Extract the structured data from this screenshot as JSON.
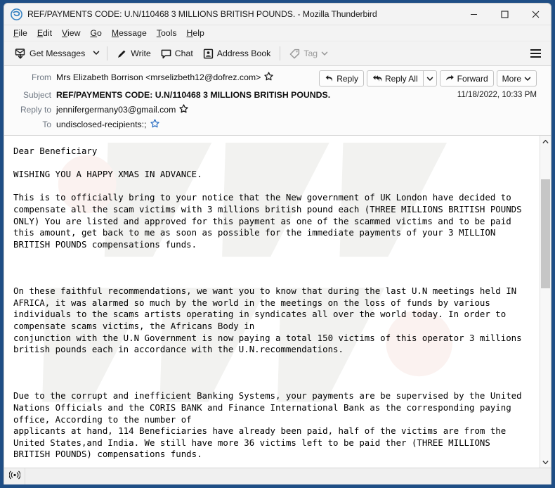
{
  "window": {
    "title": "REF/PAYMENTS CODE: U.N/110468 3 MILLIONS BRITISH POUNDS. - Mozilla Thunderbird",
    "app_icon": "thunderbird-icon",
    "controls": {
      "minimize": "minimize-icon",
      "maximize": "maximize-icon",
      "close": "close-icon"
    },
    "accent_color": "#1f4e85",
    "chrome_color": "#f3f3f3"
  },
  "menubar": {
    "items": [
      {
        "label": "File",
        "accel": "F"
      },
      {
        "label": "Edit",
        "accel": "E"
      },
      {
        "label": "View",
        "accel": "V"
      },
      {
        "label": "Go",
        "accel": "G"
      },
      {
        "label": "Message",
        "accel": "M"
      },
      {
        "label": "Tools",
        "accel": "T"
      },
      {
        "label": "Help",
        "accel": "H"
      }
    ]
  },
  "toolbar": {
    "get_messages_label": "Get Messages",
    "get_messages_icon": "download-mail-icon",
    "get_messages_caret": "chevron-down-icon",
    "write_label": "Write",
    "write_icon": "pencil-icon",
    "chat_label": "Chat",
    "chat_icon": "chat-bubble-icon",
    "address_book_label": "Address Book",
    "address_book_icon": "address-book-icon",
    "tag_label": "Tag",
    "tag_icon": "tag-icon",
    "tag_caret": "chevron-down-icon",
    "tag_disabled": true,
    "app_menu_icon": "hamburger-menu-icon"
  },
  "message_header": {
    "from_label": "From",
    "from_value": "Mrs Elizabeth Borrison <mrselizbeth12@dofrez.com>",
    "from_star_icon": "star-icon",
    "subject_label": "Subject",
    "subject_value": "REF/PAYMENTS CODE: U.N/110468 3 MILLIONS BRITISH POUNDS.",
    "timestamp": "11/18/2022, 10:33 PM",
    "replyto_label": "Reply to",
    "replyto_value": "jennifergermany03@gmail.com",
    "replyto_star_icon": "star-icon",
    "to_label": "To",
    "to_value": "undisclosed-recipients:;",
    "to_star_icon": "star-outline-blue-icon"
  },
  "message_actions": {
    "reply_label": "Reply",
    "reply_icon": "reply-arrow-icon",
    "reply_all_label": "Reply All",
    "reply_all_icon": "reply-all-arrow-icon",
    "reply_all_caret": "chevron-down-icon",
    "forward_label": "Forward",
    "forward_icon": "forward-arrow-icon",
    "more_label": "More",
    "more_caret": "chevron-down-icon"
  },
  "message_body": {
    "text": "Dear Beneficiary\n\nWISHING YOU A HAPPY XMAS IN ADVANCE.\n\nThis is to officially bring to your notice that the New government of UK London have decided to compensate all the scam victims with 3 millions british pound each (THREE MILLIONS BRITISH POUNDS ONLY) You are listed and approved for this payment as one of the scammed victims and to be paid this amount, get back to me as soon as possible for the immediate payments of your 3 MILLION BRITISH POUNDS compensations funds.\n\n\n\nOn these faithful recommendations, we want you to know that during the last U.N meetings held IN AFRICA, it was alarmed so much by the world in the meetings on the loss of funds by various individuals to the scams artists operating in syndicates all over the world today. In order to compensate scams victims, the Africans Body in\nconjunction with the U.N Government is now paying a total 150 victims of this operator 3 millions british pounds each in accordance with the U.N.recommendations.\n\n\n\nDue to the corrupt and inefficient Banking Systems, your payments are be supervised by the United Nations Officials and the CORIS BANK and Finance International Bank as the corresponding paying office, According to the number of\napplicants at hand, 114 Beneficiaries have already been paid, half of the victims are from the United States,and India. We still have more 36 victims left to be paid ther (THREE MILLIONS BRITISH POUNDS) compensations funds."
  },
  "scrollbar": {
    "up_icon": "chevron-up-icon",
    "down_icon": "chevron-down-icon",
    "thumb": "scrollbar-thumb"
  },
  "statusbar": {
    "connection_icon": "online-status-icon"
  }
}
